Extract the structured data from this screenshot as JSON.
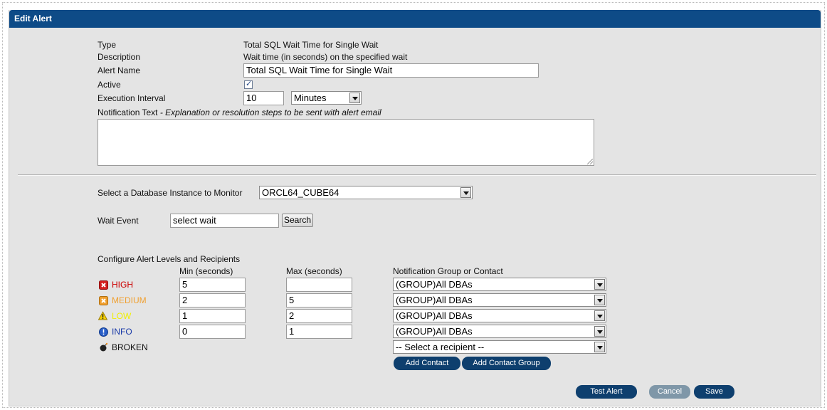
{
  "panel": {
    "title": "Edit Alert"
  },
  "form": {
    "type_label": "Type",
    "type_value": "Total SQL Wait Time for Single Wait",
    "description_label": "Description",
    "description_value": "Wait time (in seconds) on the specified wait",
    "alert_name_label": "Alert Name",
    "alert_name_value": "Total SQL Wait Time for Single Wait",
    "active_label": "Active",
    "active_checked": true,
    "execution_interval_label": "Execution Interval",
    "execution_interval_value": "10",
    "execution_interval_unit": "Minutes",
    "notification_text_label": "Notification Text",
    "notification_text_hint": " - Explanation or resolution steps to be sent with alert email",
    "notification_text_value": ""
  },
  "monitor": {
    "instance_label": "Select a Database Instance to Monitor",
    "instance_value": "ORCL64_CUBE64",
    "wait_event_label": "Wait Event",
    "wait_event_value": "select wait",
    "search_button": "Search"
  },
  "levels": {
    "section_title": "Configure Alert Levels and Recipients",
    "col_min": "Min (seconds)",
    "col_max": "Max (seconds)",
    "col_contact": "Notification Group or Contact",
    "rows": [
      {
        "name": "HIGH",
        "icon": "high-error-icon",
        "color": "#cc0000",
        "min": "5",
        "max": "",
        "contact": "(GROUP)All DBAs"
      },
      {
        "name": "MEDIUM",
        "icon": "medium-warning-icon",
        "color": "#f0a030",
        "min": "2",
        "max": "5",
        "contact": "(GROUP)All DBAs"
      },
      {
        "name": "LOW",
        "icon": "low-warning-triangle-icon",
        "color": "#f0f000",
        "min": "1",
        "max": "2",
        "contact": "(GROUP)All DBAs"
      },
      {
        "name": "INFO",
        "icon": "info-icon",
        "color": "#1a3aa8",
        "min": "0",
        "max": "1",
        "contact": "(GROUP)All DBAs"
      },
      {
        "name": "BROKEN",
        "icon": "bomb-icon",
        "color": "#111111",
        "contact": "-- Select a recipient --"
      }
    ],
    "add_contact_button": "Add Contact",
    "add_contact_group_button": "Add Contact Group"
  },
  "actions": {
    "test_alert": "Test Alert",
    "cancel": "Cancel",
    "save": "Save"
  },
  "colors": {
    "title_bar": "#0e4b87",
    "button": "#0e3f6e",
    "button_disabled": "#7f97a8",
    "panel_bg": "#e4e4e4"
  }
}
